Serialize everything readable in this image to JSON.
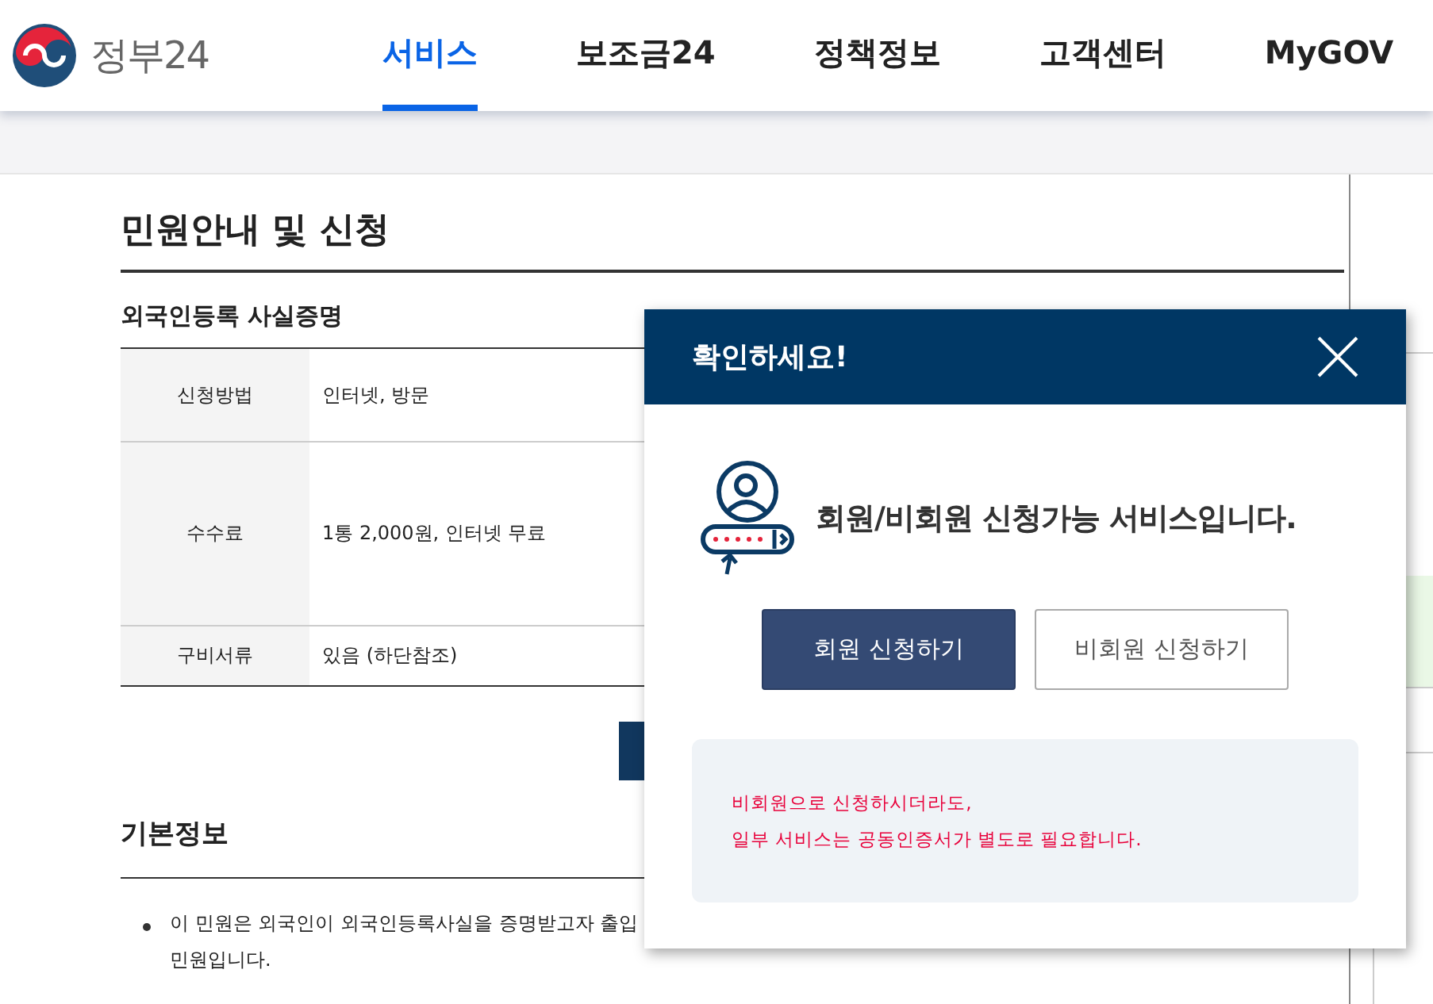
{
  "header": {
    "logo_text": "정부24",
    "nav": [
      {
        "label": "서비스",
        "selected": true
      },
      {
        "label": "보조금24",
        "selected": false
      },
      {
        "label": "정책정보",
        "selected": false
      },
      {
        "label": "고객센터",
        "selected": false
      },
      {
        "label": "MyGOV",
        "selected": false
      }
    ]
  },
  "page": {
    "title": "민원안내 및 신청",
    "service_name": "외국인등록 사실증명",
    "info_table": [
      {
        "label": "신청방법",
        "value": "인터넷, 방문"
      },
      {
        "label": "수수료",
        "value": "1통 2,000원, 인터넷 무료"
      },
      {
        "label": "구비서류",
        "value": "있음 (하단참조)"
      }
    ],
    "basic_info": {
      "title": "기본정보",
      "bullet_lines": [
        "이 민원은 외국인이 외국인등록사실을 증명받고자 출입",
        "민원입니다."
      ]
    }
  },
  "dialog": {
    "title": "확인하세요!",
    "message": "회원/비회원 신청가능 서비스입니다.",
    "buttons": [
      {
        "label": "회원 신청하기",
        "kind": "primary"
      },
      {
        "label": "비회원 신청하기",
        "kind": "secondary"
      }
    ],
    "notice": [
      "비회원으로 신청하시더라도,",
      "일부 서비스는 공동인증서가 별도로 필요합니다."
    ]
  }
}
